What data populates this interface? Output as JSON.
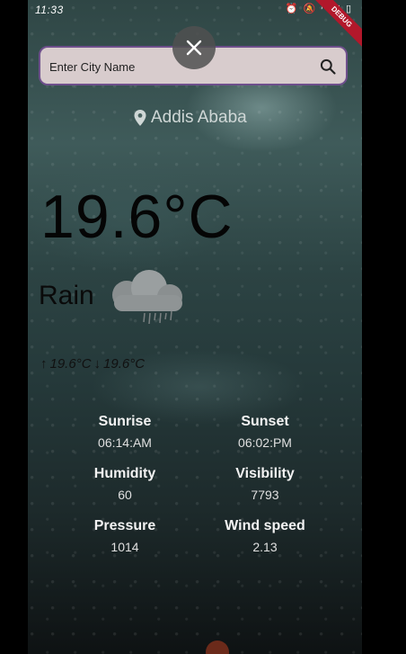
{
  "status_bar": {
    "time": "11:33",
    "icons": [
      "alarm-icon",
      "mute-icon",
      "wifi-icon",
      "signal-icon",
      "battery-icon"
    ]
  },
  "debug_banner": "DEBUG",
  "search": {
    "placeholder": "Enter City Name",
    "value": ""
  },
  "location": {
    "city": "Addis Ababa"
  },
  "weather": {
    "temperature": "19.6°C",
    "condition": "Rain",
    "temp_max": "19.6°C",
    "temp_min": "19.6°C"
  },
  "details": {
    "sunrise_label": "Sunrise",
    "sunrise_value": "06:14:AM",
    "sunset_label": "Sunset",
    "sunset_value": "06:02:PM",
    "humidity_label": "Humidity",
    "humidity_value": "60",
    "visibility_label": "Visibility",
    "visibility_value": "7793",
    "pressure_label": "Pressure",
    "pressure_value": "1014",
    "wind_label": "Wind speed",
    "wind_value": "2.13"
  },
  "colors": {
    "search_bg": "#d8cccd",
    "search_border": "#6e4f8c",
    "debug_banner": "#b2182b"
  }
}
